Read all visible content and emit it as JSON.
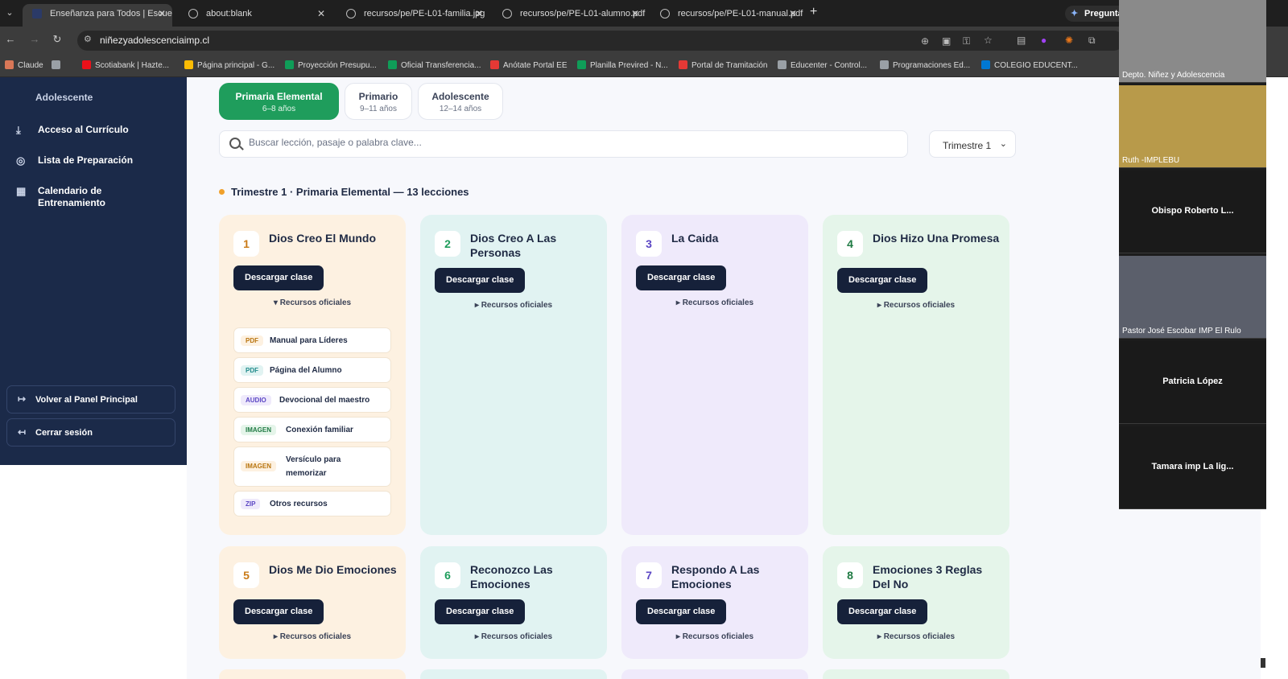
{
  "browser": {
    "tabs": [
      {
        "title": "Enseñanza para Todos | Escuela",
        "active": true
      },
      {
        "title": "about:blank"
      },
      {
        "title": "recursos/pe/PE-L01-familia.jpg"
      },
      {
        "title": "recursos/pe/PE-L01-alumno.pdf"
      },
      {
        "title": "recursos/pe/PE-L01-manual.pdf"
      }
    ],
    "ask_button": "Pregunta",
    "url": "niñezyadolescenciaimp.cl",
    "bookmarks": [
      {
        "label": "Claude",
        "color": "#d97757"
      },
      {
        "label": "",
        "color": "#9aa0a6"
      },
      {
        "label": "Scotiabank | Hazte...",
        "color": "#ec111a"
      },
      {
        "label": "Página principal - G...",
        "color": "#fbbc04"
      },
      {
        "label": "Proyección Presupu...",
        "color": "#0f9d58"
      },
      {
        "label": "Oficial Transferencia...",
        "color": "#0f9d58"
      },
      {
        "label": "Anótate Portal EE",
        "color": "#e53935"
      },
      {
        "label": "Planilla Previred - N...",
        "color": "#0f9d58"
      },
      {
        "label": "Portal de Tramitación",
        "color": "#e53935"
      },
      {
        "label": "Educenter - Control...",
        "color": "#9aa0a6"
      },
      {
        "label": "Programaciones Ed...",
        "color": "#9aa0a6"
      },
      {
        "label": "COLEGIO EDUCENT...",
        "color": "#0078d4"
      }
    ]
  },
  "sidebar": {
    "heading": "Adolescente",
    "items": [
      {
        "label": "Acceso al Currículo",
        "icon": "download-icon"
      },
      {
        "label": "Lista de Preparación",
        "icon": "check-circle-icon"
      },
      {
        "label": "Calendario de Entrenamiento",
        "icon": "calendar-icon"
      }
    ],
    "back_button": "Volver al Panel Principal",
    "logout_button": "Cerrar sesión"
  },
  "levels": [
    {
      "name": "Primaria Elemental",
      "ages": "6–8 años",
      "selected": true
    },
    {
      "name": "Primario",
      "ages": "9–11 años"
    },
    {
      "name": "Adolescente",
      "ages": "12–14 años"
    }
  ],
  "search": {
    "placeholder": "Buscar lección, pasaje o palabra clave...",
    "value": ""
  },
  "trimester_select": {
    "value": "Trimestre 1"
  },
  "section_heading": "Trimestre 1 · Primaria Elemental — 13 lecciones",
  "cards": [
    {
      "num": "1",
      "title": "Dios Creo El Mundo",
      "download": "Descargar clase",
      "resources_toggle": "▾ Recursos oficiales",
      "bg": "#fdf1e1",
      "num_color": "#c97a17",
      "expanded": true
    },
    {
      "num": "2",
      "title": "Dios Creo A Las Personas",
      "download": "Descargar clase",
      "resources_toggle": "▸ Recursos oficiales",
      "bg": "#e1f3f2",
      "num_color": "#1f9d5c"
    },
    {
      "num": "3",
      "title": "La Caida",
      "download": "Descargar clase",
      "resources_toggle": "▸ Recursos oficiales",
      "bg": "#efeafb",
      "num_color": "#5b46c4"
    },
    {
      "num": "4",
      "title": "Dios Hizo Una Promesa",
      "download": "Descargar clase",
      "resources_toggle": "▸ Recursos oficiales",
      "bg": "#e5f5ea",
      "num_color": "#1f7a43"
    },
    {
      "num": "5",
      "title": "Dios Me Dio Emociones",
      "download": "Descargar clase",
      "resources_toggle": "▸ Recursos oficiales",
      "bg": "#fdf1e1",
      "num_color": "#c97a17"
    },
    {
      "num": "6",
      "title": "Reconozco Las Emociones",
      "download": "Descargar clase",
      "resources_toggle": "▸ Recursos oficiales",
      "bg": "#e1f3f2",
      "num_color": "#1f9d5c"
    },
    {
      "num": "7",
      "title": "Respondo A Las Emociones",
      "download": "Descargar clase",
      "resources_toggle": "▸ Recursos oficiales",
      "bg": "#efeafb",
      "num_color": "#5b46c4"
    },
    {
      "num": "8",
      "title": "Emociones 3 Reglas Del No",
      "download": "Descargar clase",
      "resources_toggle": "▸ Recursos oficiales",
      "bg": "#e5f5ea",
      "num_color": "#1f7a43"
    }
  ],
  "resources": [
    {
      "type": "PDF",
      "label": "Manual para Líderes",
      "badge_bg": "#fdf1e1",
      "badge_color": "#b8740e"
    },
    {
      "type": "PDF",
      "label": "Página del Alumno",
      "badge_bg": "#e1f3f2",
      "badge_color": "#1f8a8a"
    },
    {
      "type": "AUDIO",
      "label": "Devocional del maestro",
      "badge_bg": "#efeafb",
      "badge_color": "#5b46c4"
    },
    {
      "type": "IMAGEN",
      "label": "Conexión familiar",
      "badge_bg": "#e5f5ea",
      "badge_color": "#1f7a43"
    },
    {
      "type": "IMAGEN",
      "label": "Versículo para memorizar",
      "badge_bg": "#fdf1e1",
      "badge_color": "#b8740e"
    },
    {
      "type": "ZIP",
      "label": "Otros recursos",
      "badge_bg": "#efeafb",
      "badge_color": "#5b46c4"
    }
  ],
  "call": {
    "participants": [
      {
        "name": "Depto. Niñez y Adolescencia",
        "video": true,
        "bg": "#8a8a8a"
      },
      {
        "name": "Ruth -IMPLEBU",
        "video": true,
        "bg": "#b89a4a"
      },
      {
        "name": "Obispo Roberto L...",
        "video": false
      },
      {
        "name": "Pastor José Escobar IMP El Rulo",
        "video": true,
        "bg": "#5b5f6b"
      },
      {
        "name": "Patricia López",
        "video": false
      },
      {
        "name": "Tamara imp La lig...",
        "video": false
      }
    ]
  }
}
